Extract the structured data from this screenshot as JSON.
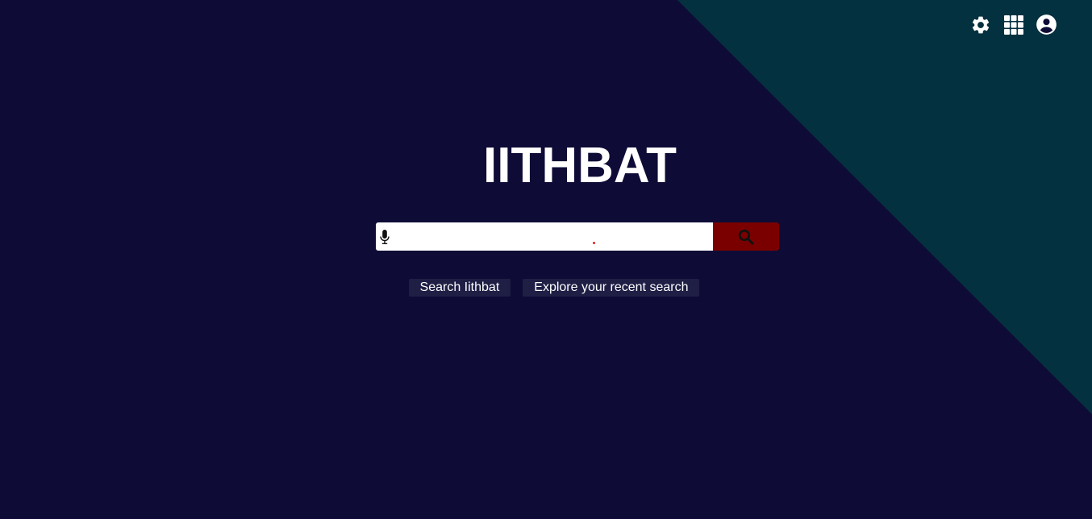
{
  "app": {
    "logo_text": "IITHBAT"
  },
  "header": {
    "icons": [
      "gear-icon",
      "apps-grid-icon",
      "account-circle-icon"
    ]
  },
  "search": {
    "value": "",
    "placeholder": "",
    "mic_icon": "microphone-icon",
    "button_icon": "search-icon"
  },
  "quick_links": {
    "search_label": "Search Iithbat",
    "explore_label": "Explore your recent search"
  },
  "colors": {
    "background": "#0e0c36",
    "triangle": "#04313f",
    "search_button": "#7a0000",
    "quick_button": "#1f1e45",
    "text": "#ffffff"
  }
}
